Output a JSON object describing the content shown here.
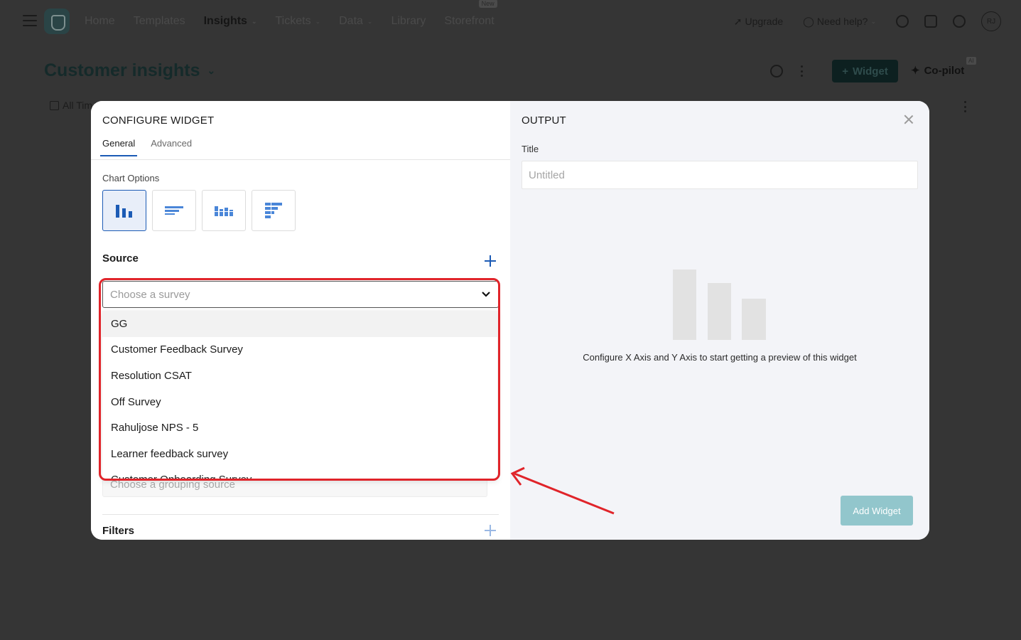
{
  "nav": {
    "items": [
      {
        "label": "Home",
        "active": false,
        "has_chevron": false
      },
      {
        "label": "Templates",
        "active": false,
        "has_chevron": false
      },
      {
        "label": "Insights",
        "active": true,
        "has_chevron": true
      },
      {
        "label": "Tickets",
        "active": false,
        "has_chevron": true
      },
      {
        "label": "Data",
        "active": false,
        "has_chevron": true
      },
      {
        "label": "Library",
        "active": false,
        "has_chevron": false
      },
      {
        "label": "Storefront",
        "active": false,
        "has_chevron": false
      }
    ],
    "storefront_badge": "New",
    "upgrade": "Upgrade",
    "need_help": "Need help?",
    "avatar_initials": "RJ"
  },
  "page": {
    "title": "Customer insights",
    "widget_button": "Widget",
    "copilot": "Co-pilot",
    "copilot_badge": "AI",
    "time_filter": "All Tim"
  },
  "configure": {
    "heading": "CONFIGURE WIDGET",
    "tabs": [
      "General",
      "Advanced"
    ],
    "chart_options_label": "Chart Options",
    "chart_types": [
      "vertical-bar",
      "horizontal-bar",
      "grouped-bar",
      "stacked-horizontal-bar"
    ],
    "source_label": "Source",
    "source_placeholder": "Choose a survey",
    "survey_options": [
      "GG",
      "Customer Feedback Survey",
      "Resolution CSAT",
      "Off Survey",
      "Rahuljose NPS - 5",
      "Learner feedback survey",
      "Customer Onboarding Survey"
    ],
    "grouping_placeholder": "Choose a grouping source",
    "filters_label": "Filters"
  },
  "output": {
    "heading": "OUTPUT",
    "title_label": "Title",
    "title_placeholder": "Untitled",
    "preview_message": "Configure X Axis and Y Axis to start getting a preview of this widget",
    "add_widget_button": "Add Widget"
  },
  "colors": {
    "accent": "#1c5bb5",
    "annotation": "#e0242a",
    "add_widget_bg": "#92c6cc",
    "overlay_bg": "#353535"
  }
}
